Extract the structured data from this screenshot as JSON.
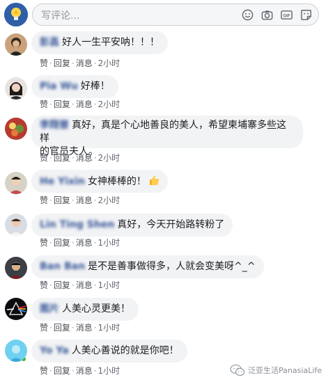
{
  "composer": {
    "placeholder": "写评论...",
    "tools": [
      "emoji-icon",
      "camera-icon",
      "gif-icon",
      "sticker-icon"
    ],
    "gif_label": "GIF"
  },
  "actions": {
    "like": "赞",
    "reply": "回复",
    "message": "消息"
  },
  "comments": [
    {
      "name": "彭昌",
      "text": "好人一生平安呐！！！",
      "time": "2小时"
    },
    {
      "name": "Pia Wu",
      "text": "好棒！",
      "time": "2小时"
    },
    {
      "name": "李翔普",
      "text": "真好，真是个心地善良的美人，希望柬埔寨多些这样",
      "text2": "的官员夫人。",
      "time": "2小时"
    },
    {
      "name": "He Yixin",
      "text": "女神棒棒的！",
      "time": "2小时"
    },
    {
      "name": "Lin Ting Shen",
      "text": "真好，今天开始路转粉了",
      "time": "1小时"
    },
    {
      "name": "Ban Ban",
      "text": "是不是善事做得多，人就会变美呀^_^",
      "time": "1小时"
    },
    {
      "name": "图片",
      "text": "人美心灵更美！",
      "time": "1小时"
    },
    {
      "name": "Yo Ya",
      "text": "人美心善说的就是你吧！",
      "time": "1小时"
    }
  ],
  "watermark": "泛亚生活PanasiaLife",
  "colors": {
    "name": "#385898",
    "bubble": "#f2f3f5",
    "online": "#42b72a"
  }
}
